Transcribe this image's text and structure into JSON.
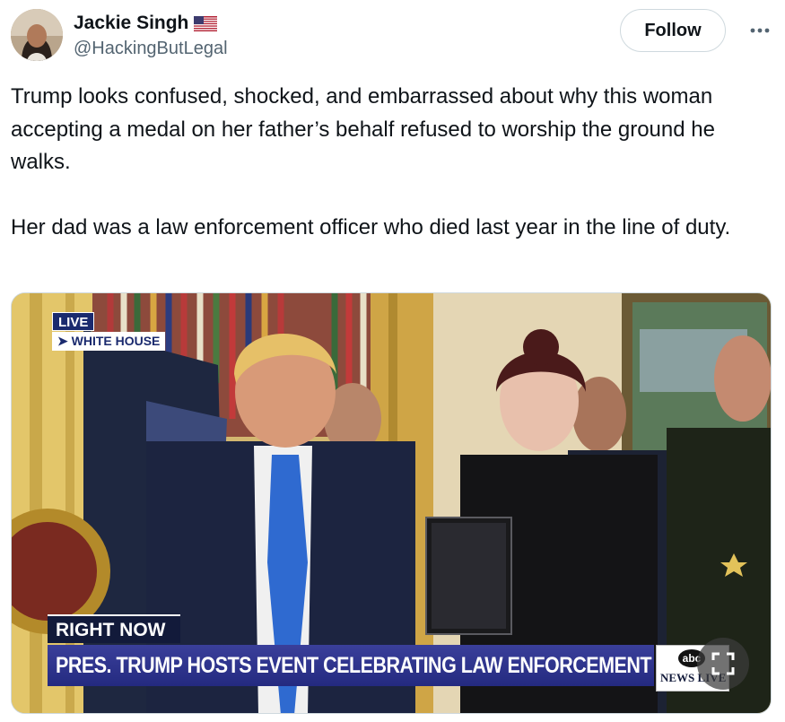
{
  "author": {
    "display_name": "Jackie Singh",
    "handle": "@HackingButLegal",
    "flag_icon": "us-flag-icon"
  },
  "actions": {
    "follow_label": "Follow",
    "more_icon": "more-horizontal-icon"
  },
  "tweet": {
    "text": "Trump looks confused, shocked, and embarrassed about why this woman accepting a medal on her father’s behalf refused to worship the ground he walks.\n\nHer dad was a law enforcement officer who died last year in the line of duty."
  },
  "media": {
    "live_label": "LIVE",
    "location_label": "➤ WHITE HOUSE",
    "right_now_label": "RIGHT NOW",
    "headline": "PRES. TRUMP HOSTS EVENT CELEBRATING LAW ENFORCEMENT",
    "network_logo": "abc",
    "network_label": "NEWS LIVE",
    "expand_icon": "expand-icon"
  },
  "colors": {
    "follow_border": "#cfd9de",
    "handle_gray": "#536471",
    "chyron_blue": "#2a2f88",
    "chyron_dark": "#121a3a"
  }
}
